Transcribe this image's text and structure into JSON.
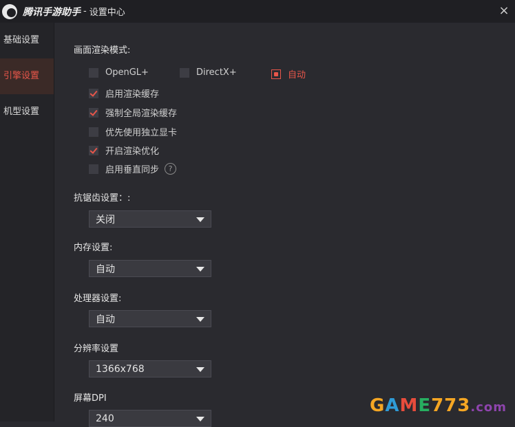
{
  "titlebar": {
    "app_name": "腾讯手游助手",
    "separator": "-",
    "subtitle": "设置中心",
    "close_symbol": "×"
  },
  "sidebar": {
    "items": [
      {
        "label": "基础设置",
        "active": false
      },
      {
        "label": "引擎设置",
        "active": true
      },
      {
        "label": "机型设置",
        "active": false
      }
    ]
  },
  "render_mode": {
    "label": "画面渲染模式:",
    "options": [
      {
        "label": "OpenGL+",
        "selected": false
      },
      {
        "label": "DirectX+",
        "selected": false
      },
      {
        "label": "自动",
        "selected": true
      }
    ]
  },
  "checkboxes": [
    {
      "label": "启用渲染缓存",
      "checked": true
    },
    {
      "label": "强制全局渲染缓存",
      "checked": true
    },
    {
      "label": "优先使用独立显卡",
      "checked": false
    },
    {
      "label": "开启渲染优化",
      "checked": true
    },
    {
      "label": "启用垂直同步",
      "checked": false
    }
  ],
  "help_icon": "?",
  "antialias": {
    "label": "抗锯齿设置：:",
    "value": "关闭"
  },
  "memory": {
    "label": "内存设置:",
    "value": "自动"
  },
  "cpu": {
    "label": "处理器设置:",
    "value": "自动"
  },
  "resolution": {
    "label": "分辨率设置",
    "value": "1366x768"
  },
  "dpi": {
    "label": "屏幕DPI",
    "value": "240"
  },
  "watermark": {
    "g": "G",
    "a": "A",
    "m": "M",
    "e": "E",
    "num": "773",
    "dot": ".com"
  },
  "colors": {
    "accent": "#e8564a",
    "background": "#2a2a2f",
    "sidebar": "#242428"
  }
}
